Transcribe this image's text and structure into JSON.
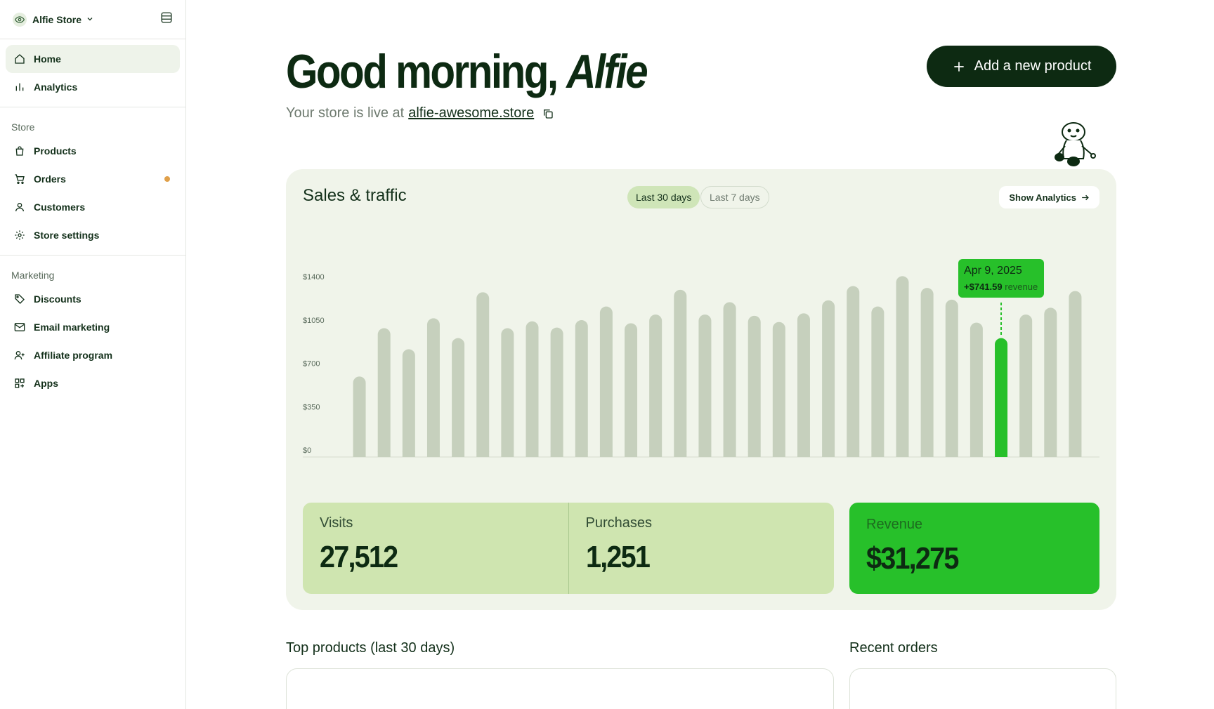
{
  "store": {
    "name": "Alfie Store"
  },
  "sidebar": {
    "main_items": [
      {
        "label": "Home",
        "icon": "home-icon",
        "active": true
      },
      {
        "label": "Analytics",
        "icon": "bar-chart-icon"
      }
    ],
    "store_section": {
      "title": "Store",
      "items": [
        {
          "label": "Products",
          "icon": "bag-icon"
        },
        {
          "label": "Orders",
          "icon": "cart-icon",
          "badge_color": "#e0a04a"
        },
        {
          "label": "Customers",
          "icon": "user-icon"
        },
        {
          "label": "Store settings",
          "icon": "gear-icon"
        }
      ]
    },
    "marketing_section": {
      "title": "Marketing",
      "items": [
        {
          "label": "Discounts",
          "icon": "tag-icon"
        },
        {
          "label": "Email marketing",
          "icon": "mail-icon"
        },
        {
          "label": "Affiliate program",
          "icon": "user-plus-icon"
        },
        {
          "label": "Apps",
          "icon": "apps-icon"
        }
      ]
    }
  },
  "header": {
    "greeting": "Good morning,",
    "name": "Alfie",
    "live_text": "Your store is live at",
    "store_url": "alfie-awesome.store",
    "add_button": "Add a new product"
  },
  "card": {
    "title": "Sales & traffic",
    "range_options": [
      "Last 30 days",
      "Last 7 days"
    ],
    "selected_range": "Last 30 days",
    "show_analytics": "Show Analytics"
  },
  "tooltip": {
    "date": "Apr 9, 2025",
    "value": "+$741.59",
    "suffix": "revenue"
  },
  "stats": {
    "visits_label": "Visits",
    "visits_value": "27,512",
    "purchases_label": "Purchases",
    "purchases_value": "1,251",
    "revenue_label": "Revenue",
    "revenue_value": "$31,275"
  },
  "sections": {
    "top_products": "Top products (last 30 days)",
    "recent_orders": "Recent orders"
  },
  "colors": {
    "accent": "#27c02a",
    "dark": "#0d2a12",
    "bar": "#c6d0bd",
    "card_bg": "#f0f4ea"
  },
  "chart_data": {
    "type": "bar",
    "ytick_labels": [
      "$0",
      "$350",
      "$700",
      "$1050",
      "$1400"
    ],
    "ylim": [
      0,
      1400
    ],
    "values": [
      650,
      1040,
      870,
      1120,
      960,
      1330,
      1040,
      1095,
      1045,
      1105,
      1215,
      1080,
      1150,
      1350,
      1150,
      1250,
      1140,
      1090,
      1160,
      1265,
      1380,
      1215,
      1460,
      1365,
      1270,
      1085,
      960,
      1150,
      1205,
      1340
    ],
    "highlight_index": 26,
    "grid": false
  }
}
